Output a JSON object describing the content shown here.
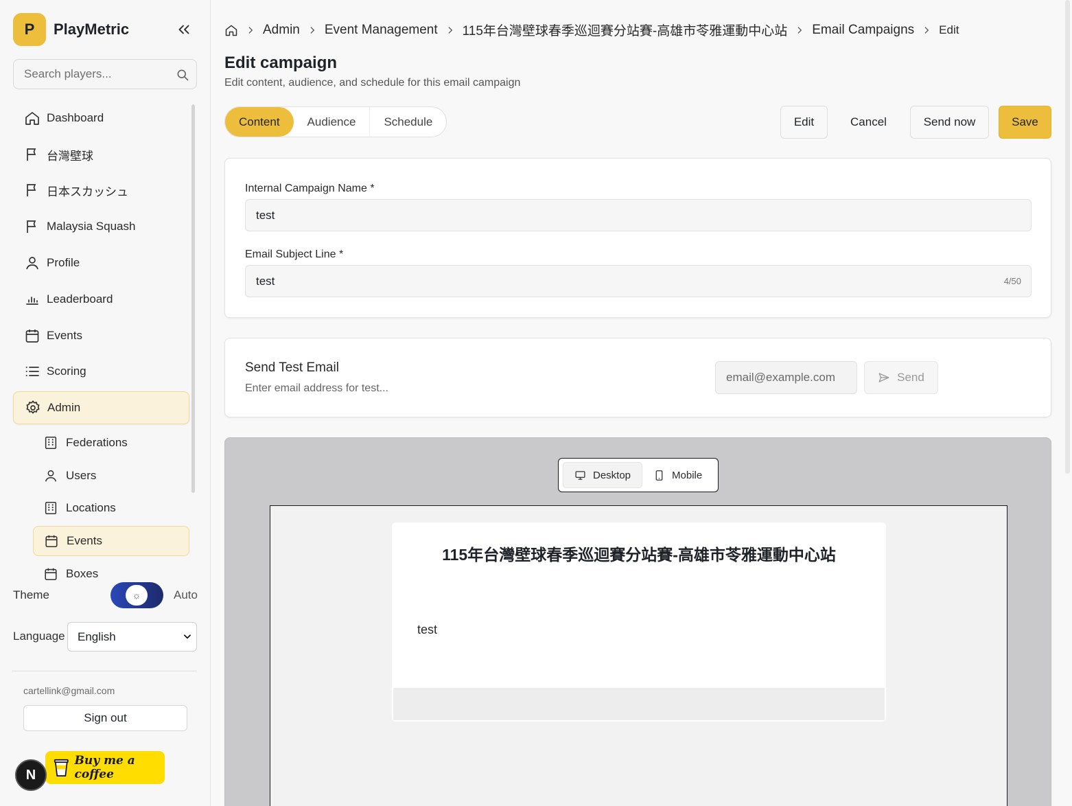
{
  "app": {
    "name": "PlayMetric",
    "logo_letter": "P"
  },
  "search": {
    "placeholder": "Search players..."
  },
  "sidebar": {
    "items": [
      {
        "label": "Dashboard",
        "icon": "home-icon"
      },
      {
        "label": "台灣壁球",
        "icon": "flag-icon"
      },
      {
        "label": "日本スカッシュ",
        "icon": "flag-icon"
      },
      {
        "label": "Malaysia Squash",
        "icon": "flag-icon"
      },
      {
        "label": "Profile",
        "icon": "user-icon"
      },
      {
        "label": "Leaderboard",
        "icon": "bar-chart-icon"
      },
      {
        "label": "Events",
        "icon": "calendar-icon"
      },
      {
        "label": "Scoring",
        "icon": "list-icon"
      },
      {
        "label": "Admin",
        "icon": "gear-icon",
        "active": true
      }
    ],
    "sub_items": [
      {
        "label": "Federations",
        "icon": "building-icon"
      },
      {
        "label": "Users",
        "icon": "user-icon"
      },
      {
        "label": "Locations",
        "icon": "building-icon"
      },
      {
        "label": "Events",
        "icon": "calendar-icon",
        "active": true
      },
      {
        "label": "Boxes",
        "icon": "calendar-icon"
      }
    ],
    "theme_label": "Theme",
    "theme_value": "Auto",
    "language_label": "Language",
    "language_value": "English",
    "user_email": "cartellink@gmail.com",
    "sign_out": "Sign out",
    "next_badge": "N",
    "bmc_label": "Buy me a coffee"
  },
  "breadcrumb": {
    "items": [
      "Admin",
      "Event Management",
      "115年台灣壁球春季巡迴賽分站賽-高雄市苓雅運動中心站",
      "Email Campaigns"
    ],
    "current": "Edit"
  },
  "page": {
    "title": "Edit campaign",
    "subtitle": "Edit content, audience, and schedule for this email campaign"
  },
  "tabs": [
    {
      "label": "Content",
      "active": true
    },
    {
      "label": "Audience"
    },
    {
      "label": "Schedule"
    }
  ],
  "actions": {
    "edit": "Edit",
    "cancel": "Cancel",
    "send_now": "Send now",
    "save": "Save"
  },
  "form": {
    "name_label": "Internal Campaign Name *",
    "name_value": "test",
    "subject_label": "Email Subject Line *",
    "subject_value": "test",
    "subject_counter": "4/50"
  },
  "test_email": {
    "title": "Send Test Email",
    "subtitle": "Enter email address for test...",
    "placeholder": "email@example.com",
    "send_label": "Send"
  },
  "preview": {
    "desktop_label": "Desktop",
    "mobile_label": "Mobile",
    "email_title": "115年台灣壁球春季巡迴賽分站賽-高雄市苓雅運動中心站",
    "email_body": "test"
  },
  "colors": {
    "accent": "#ecbe3b",
    "active_bg": "#fbf2dc",
    "bmc": "#ffdd00"
  }
}
